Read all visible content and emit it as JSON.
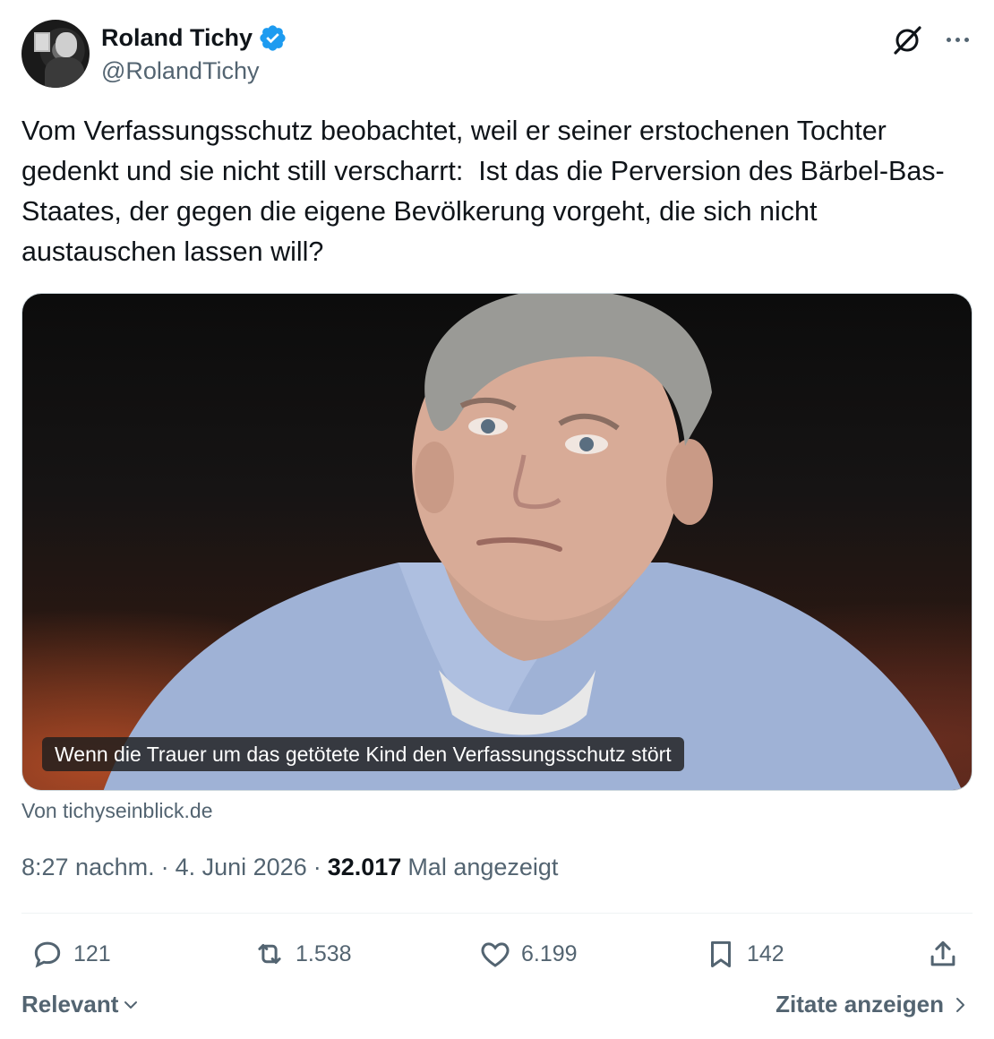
{
  "author": {
    "display_name": "Roland Tichy",
    "handle": "@RolandTichy",
    "verified_color": "#1d9bf0"
  },
  "icons": {
    "grok": "grok-icon",
    "more": "more-icon"
  },
  "tweet": {
    "text": "Vom Verfassungsschutz beobachtet, weil er seiner erstochenen Tochter gedenkt und sie nicht still verscharrt:  Ist das die Perversion des Bärbel-Bas-Staates, der gegen die eigene Bevölkerung vorgeht, die sich nicht austauschen lassen will?"
  },
  "media": {
    "caption": "Wenn die Trauer um das getötete Kind den Verfassungsschutz stört",
    "source": "Von tichyseinblick.de"
  },
  "meta": {
    "time": "8:27 nachm.",
    "separator1": "·",
    "date": "4. Juni 2026",
    "separator2": "·",
    "views_count": "32.017",
    "views_label": "Mal angezeigt"
  },
  "actions": {
    "replies": "121",
    "reposts": "1.538",
    "likes": "6.199",
    "bookmarks": "142"
  },
  "bottom": {
    "sort_label": "Relevant",
    "quotes_label": "Zitate anzeigen"
  }
}
